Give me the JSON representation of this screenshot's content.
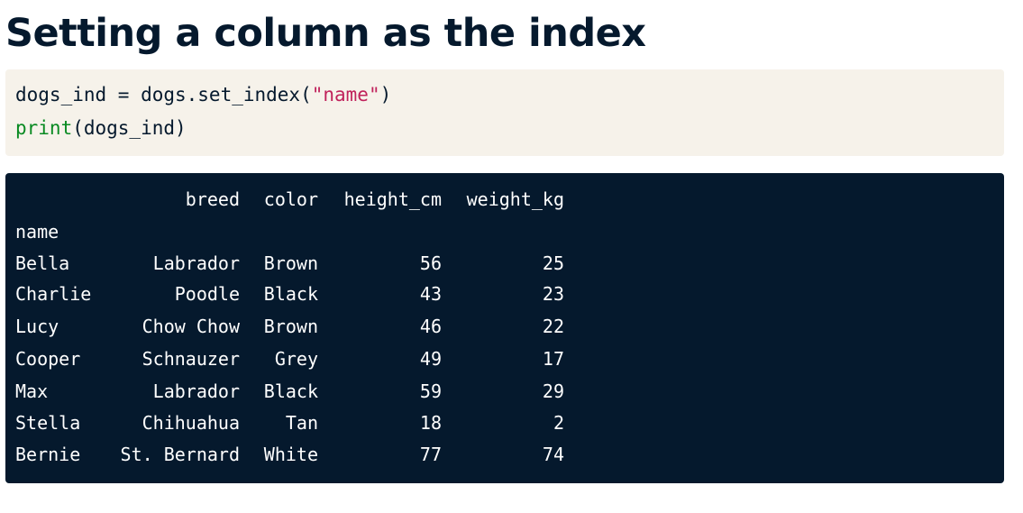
{
  "title": "Setting a column as the index",
  "code": {
    "line1": {
      "prefix": "dogs_ind = dogs.set_index(",
      "string": "\"name\"",
      "suffix": ")"
    },
    "line2": {
      "fn": "print",
      "args": "(dogs_ind)"
    }
  },
  "output": {
    "columns": [
      "breed",
      "color",
      "height_cm",
      "weight_kg"
    ],
    "index_name": "name",
    "rows": [
      {
        "name": "Bella",
        "breed": "Labrador",
        "color": "Brown",
        "height_cm": "56",
        "weight_kg": "25"
      },
      {
        "name": "Charlie",
        "breed": "Poodle",
        "color": "Black",
        "height_cm": "43",
        "weight_kg": "23"
      },
      {
        "name": "Lucy",
        "breed": "Chow Chow",
        "color": "Brown",
        "height_cm": "46",
        "weight_kg": "22"
      },
      {
        "name": "Cooper",
        "breed": "Schnauzer",
        "color": "Grey",
        "height_cm": "49",
        "weight_kg": "17"
      },
      {
        "name": "Max",
        "breed": "Labrador",
        "color": "Black",
        "height_cm": "59",
        "weight_kg": "29"
      },
      {
        "name": "Stella",
        "breed": "Chihuahua",
        "color": "Tan",
        "height_cm": "18",
        "weight_kg": "2"
      },
      {
        "name": "Bernie",
        "breed": "St. Bernard",
        "color": "White",
        "height_cm": "77",
        "weight_kg": "74"
      }
    ]
  },
  "colors": {
    "title": "#05192d",
    "code_bg": "#f6f2ea",
    "string": "#c0225b",
    "function": "#098a22",
    "output_bg": "#05192d",
    "output_text": "#ffffff"
  }
}
